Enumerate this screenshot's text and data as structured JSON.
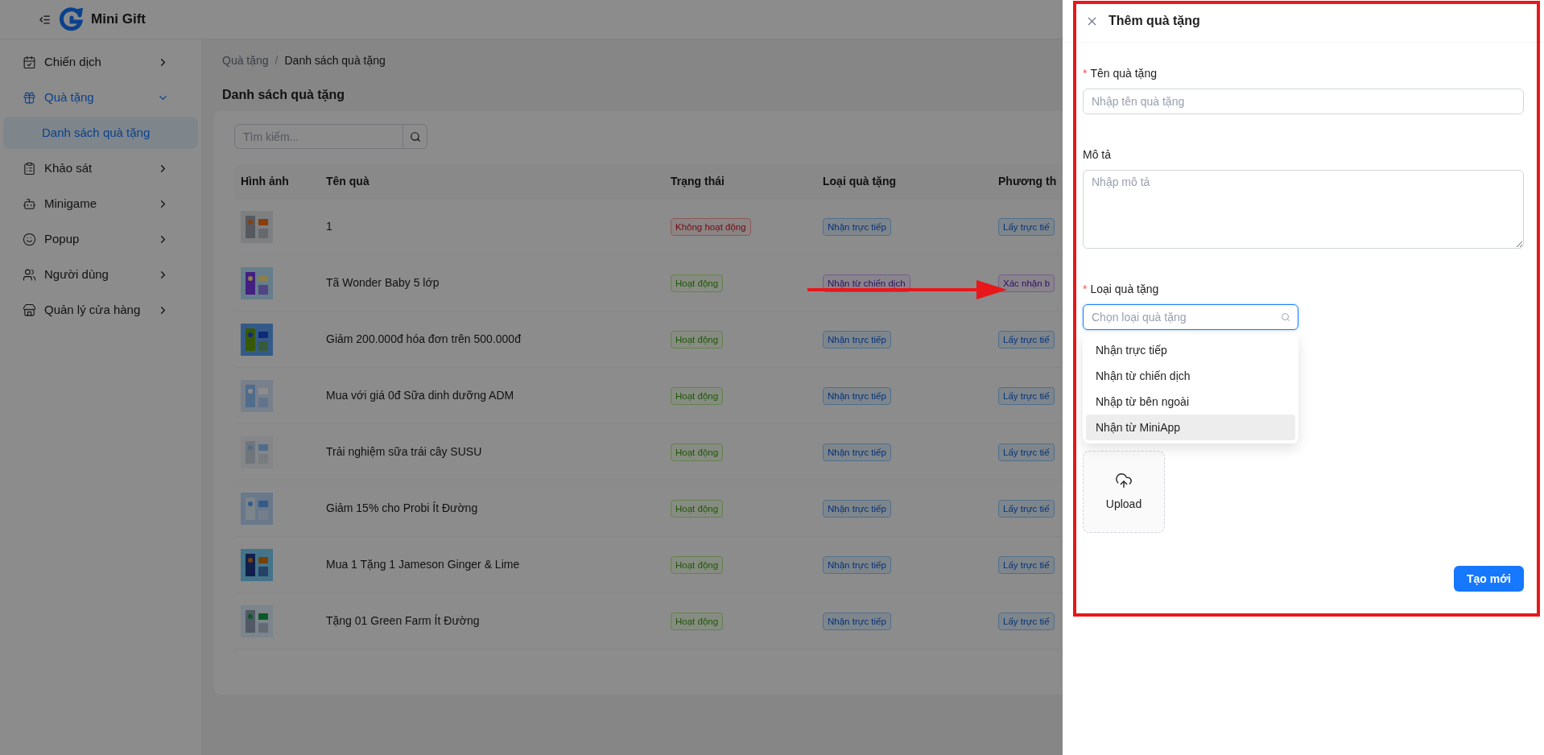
{
  "app": {
    "title": "Mini Gift"
  },
  "sidebar": {
    "items": [
      {
        "label": "Chiến dịch",
        "selected": false,
        "expanded": false
      },
      {
        "label": "Quà tặng",
        "selected": true,
        "expanded": true,
        "children": [
          {
            "label": "Danh sách quà tặng",
            "selected": true
          }
        ]
      },
      {
        "label": "Khảo sát",
        "selected": false,
        "expanded": false
      },
      {
        "label": "Minigame",
        "selected": false,
        "expanded": false
      },
      {
        "label": "Popup",
        "selected": false,
        "expanded": false
      },
      {
        "label": "Người dùng",
        "selected": false,
        "expanded": false
      },
      {
        "label": "Quản lý cửa hàng",
        "selected": false,
        "expanded": false
      }
    ]
  },
  "breadcrumb": {
    "items": [
      "Quà tặng",
      "Danh sách quà tặng"
    ],
    "separator": "/"
  },
  "page_title": "Danh sách quà tặng",
  "search": {
    "placeholder": "Tìm kiếm..."
  },
  "table": {
    "columns": [
      "Hình ảnh",
      "Tên quà",
      "Trạng thái",
      "Loại quà tặng",
      "Phương th"
    ],
    "rows": [
      {
        "name": "1",
        "status": {
          "text": "Không hoạt động",
          "kind": "danger"
        },
        "type": {
          "text": "Nhận trực tiếp",
          "kind": "info"
        },
        "method": {
          "text": "Lấy trực tiế",
          "kind": "info"
        }
      },
      {
        "name": "Tã Wonder Baby 5 lớp",
        "status": {
          "text": "Hoạt động",
          "kind": "success"
        },
        "type": {
          "text": "Nhận từ chiến dịch",
          "kind": "purple"
        },
        "method": {
          "text": "Xác nhận b",
          "kind": "purple"
        }
      },
      {
        "name": "Giảm 200.000đ hóa đơn trên 500.000đ",
        "status": {
          "text": "Hoạt động",
          "kind": "success"
        },
        "type": {
          "text": "Nhận trực tiếp",
          "kind": "info"
        },
        "method": {
          "text": "Lấy trực tiế",
          "kind": "info"
        }
      },
      {
        "name": "Mua với giá 0đ Sữa dinh dưỡng ADM",
        "status": {
          "text": "Hoạt động",
          "kind": "success"
        },
        "type": {
          "text": "Nhận trực tiếp",
          "kind": "info"
        },
        "method": {
          "text": "Lấy trực tiế",
          "kind": "info"
        }
      },
      {
        "name": "Trải nghiệm sữa trái cây SUSU",
        "status": {
          "text": "Hoạt động",
          "kind": "success"
        },
        "type": {
          "text": "Nhận trực tiếp",
          "kind": "info"
        },
        "method": {
          "text": "Lấy trực tiế",
          "kind": "info"
        }
      },
      {
        "name": "Giảm 15% cho Probi Ít Đường",
        "status": {
          "text": "Hoạt động",
          "kind": "success"
        },
        "type": {
          "text": "Nhận trực tiếp",
          "kind": "info"
        },
        "method": {
          "text": "Lấy trực tiế",
          "kind": "info"
        }
      },
      {
        "name": "Mua 1 Tặng 1 Jameson Ginger & Lime",
        "status": {
          "text": "Hoạt động",
          "kind": "success"
        },
        "type": {
          "text": "Nhận trực tiếp",
          "kind": "info"
        },
        "method": {
          "text": "Lấy trực tiế",
          "kind": "info"
        }
      },
      {
        "name": "Tặng 01 Green Farm Ít Đường",
        "status": {
          "text": "Hoạt động",
          "kind": "success"
        },
        "type": {
          "text": "Nhận trực tiếp",
          "kind": "info"
        },
        "method": {
          "text": "Lấy trực tiế",
          "kind": "info"
        }
      }
    ]
  },
  "drawer": {
    "title": "Thêm quà tặng",
    "fields": [
      {
        "kind": "input",
        "label": "Tên quà tặng",
        "required_mark": "*",
        "placeholder": "Nhập tên quà tặng"
      },
      {
        "kind": "textarea",
        "label": "Mô tả",
        "placeholder": "Nhập mô tả"
      },
      {
        "kind": "select",
        "label": "Loại quà tặng",
        "required_mark": "*",
        "placeholder": "Chọn loại quà tặng",
        "options": [
          {
            "label": "Nhận trực tiếp",
            "active": false
          },
          {
            "label": "Nhận từ chiến dịch",
            "active": false
          },
          {
            "label": "Nhập từ bên ngoài",
            "active": false
          },
          {
            "label": "Nhận từ MiniApp",
            "active": true
          }
        ]
      }
    ],
    "upload": {
      "label": "Upload"
    },
    "submit": "Tạo mới"
  }
}
